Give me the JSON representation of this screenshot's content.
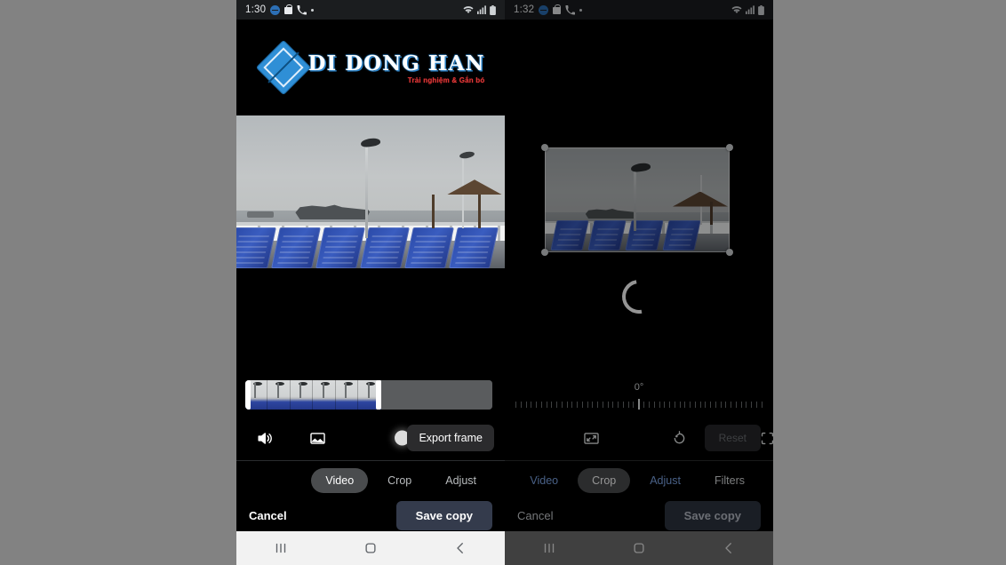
{
  "left_phone": {
    "status_bar": {
      "time": "1:30",
      "icons": [
        "do-not-disturb-icon",
        "shopping-bag-icon",
        "phone-icon",
        "dot-icon"
      ],
      "right_icons": [
        "wifi-icon",
        "signal-icon",
        "battery-icon"
      ]
    },
    "logo": {
      "title": "DI DONG HAN",
      "tagline": "Trải nghiệm & Gắn bó"
    },
    "tools": {
      "volume_icon": "volume-icon",
      "frame_icon": "frame-picture-icon",
      "export_label": "Export frame"
    },
    "tabs": [
      {
        "label": "Video",
        "state": "active"
      },
      {
        "label": "Crop",
        "state": "normal"
      },
      {
        "label": "Adjust",
        "state": "normal"
      }
    ],
    "actions": {
      "cancel": "Cancel",
      "save": "Save copy"
    },
    "nav": [
      "recents-icon",
      "home-icon",
      "back-icon"
    ]
  },
  "right_phone": {
    "status_bar": {
      "time": "1:32",
      "icons": [
        "do-not-disturb-icon",
        "shopping-bag-icon",
        "phone-icon",
        "dot-icon"
      ],
      "right_icons": [
        "wifi-icon",
        "signal-icon",
        "battery-icon"
      ]
    },
    "crop": {
      "rotation": "0°",
      "handles": [
        "top-left",
        "top-right",
        "bottom-left",
        "bottom-right"
      ],
      "loading": "loading-spinner"
    },
    "tools": {
      "aspect_icon": "aspect-ratio-icon",
      "rotate_icon": "rotate-icon",
      "free_icon": "free-crop-icon",
      "reset_label": "Reset"
    },
    "tabs": [
      {
        "label": "Video",
        "state": "link"
      },
      {
        "label": "Crop",
        "state": "active"
      },
      {
        "label": "Adjust",
        "state": "link"
      },
      {
        "label": "Filters",
        "state": "plain"
      }
    ],
    "actions": {
      "cancel": "Cancel",
      "save": "Save copy"
    },
    "nav": [
      "recents-icon",
      "home-icon",
      "back-icon"
    ]
  },
  "colors": {
    "background": "#828282",
    "phone_bg": "#000000",
    "accent_blue": "#7fa7e8",
    "logo_blue": "#2f8fd6",
    "logo_red": "#e03a3a",
    "save_button": "#343b4c"
  }
}
